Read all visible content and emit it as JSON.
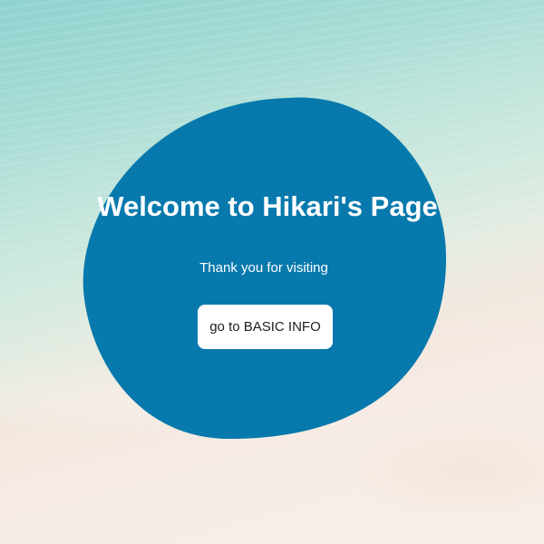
{
  "hero": {
    "title": "Welcome to Hikari's Page",
    "subtitle": "Thank you for visiting",
    "button_label": "go to BASIC INFO"
  },
  "colors": {
    "blob": "#0879ac",
    "button_bg": "#ffffff",
    "text": "#ffffff"
  }
}
